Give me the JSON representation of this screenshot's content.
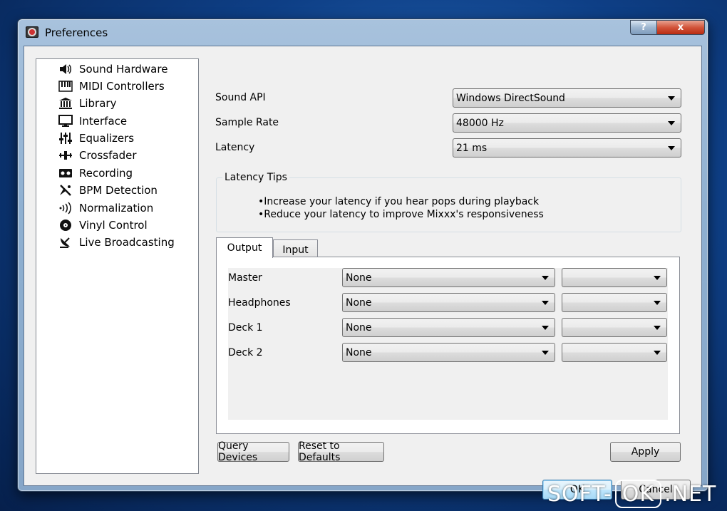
{
  "window": {
    "title": "Preferences",
    "help_glyph": "?",
    "close_glyph": "x"
  },
  "nav": {
    "items": [
      {
        "label": "Sound Hardware",
        "icon": "speaker-icon"
      },
      {
        "label": "MIDI Controllers",
        "icon": "piano-keys-icon"
      },
      {
        "label": "Library",
        "icon": "library-icon"
      },
      {
        "label": "Interface",
        "icon": "monitor-icon"
      },
      {
        "label": "Equalizers",
        "icon": "equalizer-sliders-icon"
      },
      {
        "label": "Crossfader",
        "icon": "crossfader-icon"
      },
      {
        "label": "Recording",
        "icon": "tape-recorder-icon"
      },
      {
        "label": "BPM Detection",
        "icon": "metronome-icon"
      },
      {
        "label": "Normalization",
        "icon": "sound-waves-icon"
      },
      {
        "label": "Vinyl Control",
        "icon": "vinyl-record-icon"
      },
      {
        "label": "Live Broadcasting",
        "icon": "satellite-dish-icon"
      }
    ]
  },
  "sound": {
    "api_label": "Sound API",
    "api_value": "Windows DirectSound",
    "rate_label": "Sample Rate",
    "rate_value": "48000 Hz",
    "latency_label": "Latency",
    "latency_value": "21 ms"
  },
  "tips": {
    "title": "Latency Tips",
    "lines": [
      "•Increase your latency if you hear pops during playback",
      "•Reduce your latency to improve Mixxx's responsiveness"
    ]
  },
  "tabs": {
    "output": "Output",
    "input": "Input"
  },
  "outputs": [
    {
      "label": "Master",
      "device": "None",
      "channel": ""
    },
    {
      "label": "Headphones",
      "device": "None",
      "channel": ""
    },
    {
      "label": "Deck 1",
      "device": "None",
      "channel": ""
    },
    {
      "label": "Deck 2",
      "device": "None",
      "channel": ""
    }
  ],
  "buttons": {
    "query": "Query Devices",
    "reset": "Reset to Defaults",
    "apply": "Apply",
    "ok": "OK",
    "cancel": "Cancel"
  },
  "watermark": {
    "left": "SOFT-",
    "middle": "OK",
    "right": ".NET"
  }
}
